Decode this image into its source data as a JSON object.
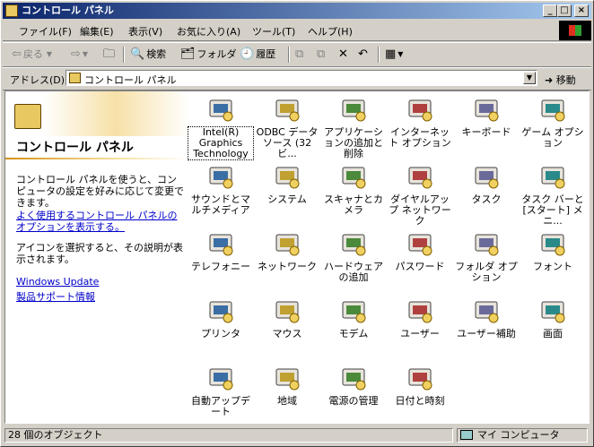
{
  "window": {
    "title": "コントロール パネル",
    "controls": {
      "minimize": "_",
      "maximize": "□",
      "close": "×"
    }
  },
  "menu": [
    "ファイル(F)",
    "編集(E)",
    "表示(V)",
    "お気に入り(A)",
    "ツール(T)",
    "ヘルプ(H)"
  ],
  "toolbar": {
    "back": "戻る",
    "search": "検索",
    "folders": "フォルダ",
    "history": "履歴"
  },
  "address": {
    "label": "アドレス(D)",
    "value": "コントロール パネル",
    "go": "移動"
  },
  "left_pane": {
    "title": "コントロール パネル",
    "description": "コントロール パネルを使うと、コンピュータの設定を好みに応じて変更できます。",
    "options_link": "よく使用するコントロール パネルのオプションを表示する。",
    "hint": "アイコンを選択すると、その説明が表示されます。",
    "links": [
      "Windows Update",
      "製品サポート情報"
    ]
  },
  "items": [
    {
      "label": "Intel(R) Graphics Technology",
      "icon": "monitor-graphics-icon"
    },
    {
      "label": "ODBC データ ソース (32ビ...",
      "icon": "database-icon"
    },
    {
      "label": "アプリケーションの追加と削除",
      "icon": "add-remove-programs-icon"
    },
    {
      "label": "インターネット オプション",
      "icon": "globe-internet-icon"
    },
    {
      "label": "キーボード",
      "icon": "keyboard-icon"
    },
    {
      "label": "ゲーム オプション",
      "icon": "joystick-icon"
    },
    {
      "label": "サウンドとマルチメディア",
      "icon": "speaker-icon"
    },
    {
      "label": "システム",
      "icon": "computer-icon"
    },
    {
      "label": "スキャナとカメラ",
      "icon": "camera-icon"
    },
    {
      "label": "ダイヤルアップ ネットワーク",
      "icon": "dialup-icon"
    },
    {
      "label": "タスク",
      "icon": "task-folder-icon"
    },
    {
      "label": "タスク バーと [スタート] メニ...",
      "icon": "taskbar-icon"
    },
    {
      "label": "テレフォニー",
      "icon": "telephony-icon"
    },
    {
      "label": "ネットワーク",
      "icon": "network-icon"
    },
    {
      "label": "ハードウェアの追加",
      "icon": "hardware-icon"
    },
    {
      "label": "パスワード",
      "icon": "keys-icon"
    },
    {
      "label": "フォルダ オプション",
      "icon": "folder-options-icon"
    },
    {
      "label": "フォント",
      "icon": "font-folder-icon"
    },
    {
      "label": "プリンタ",
      "icon": "printer-folder-icon"
    },
    {
      "label": "マウス",
      "icon": "mouse-icon"
    },
    {
      "label": "モデム",
      "icon": "modem-icon"
    },
    {
      "label": "ユーザー",
      "icon": "users-icon"
    },
    {
      "label": "ユーザー補助",
      "icon": "accessibility-icon"
    },
    {
      "label": "画面",
      "icon": "display-icon"
    },
    {
      "label": "自動アップデート",
      "icon": "auto-update-icon"
    },
    {
      "label": "地域",
      "icon": "globe-regional-icon"
    },
    {
      "label": "電源の管理",
      "icon": "power-icon"
    },
    {
      "label": "日付と時刻",
      "icon": "calendar-clock-icon"
    }
  ],
  "status": {
    "count": "28 個のオブジェクト",
    "zone": "マイ コンピュータ"
  }
}
